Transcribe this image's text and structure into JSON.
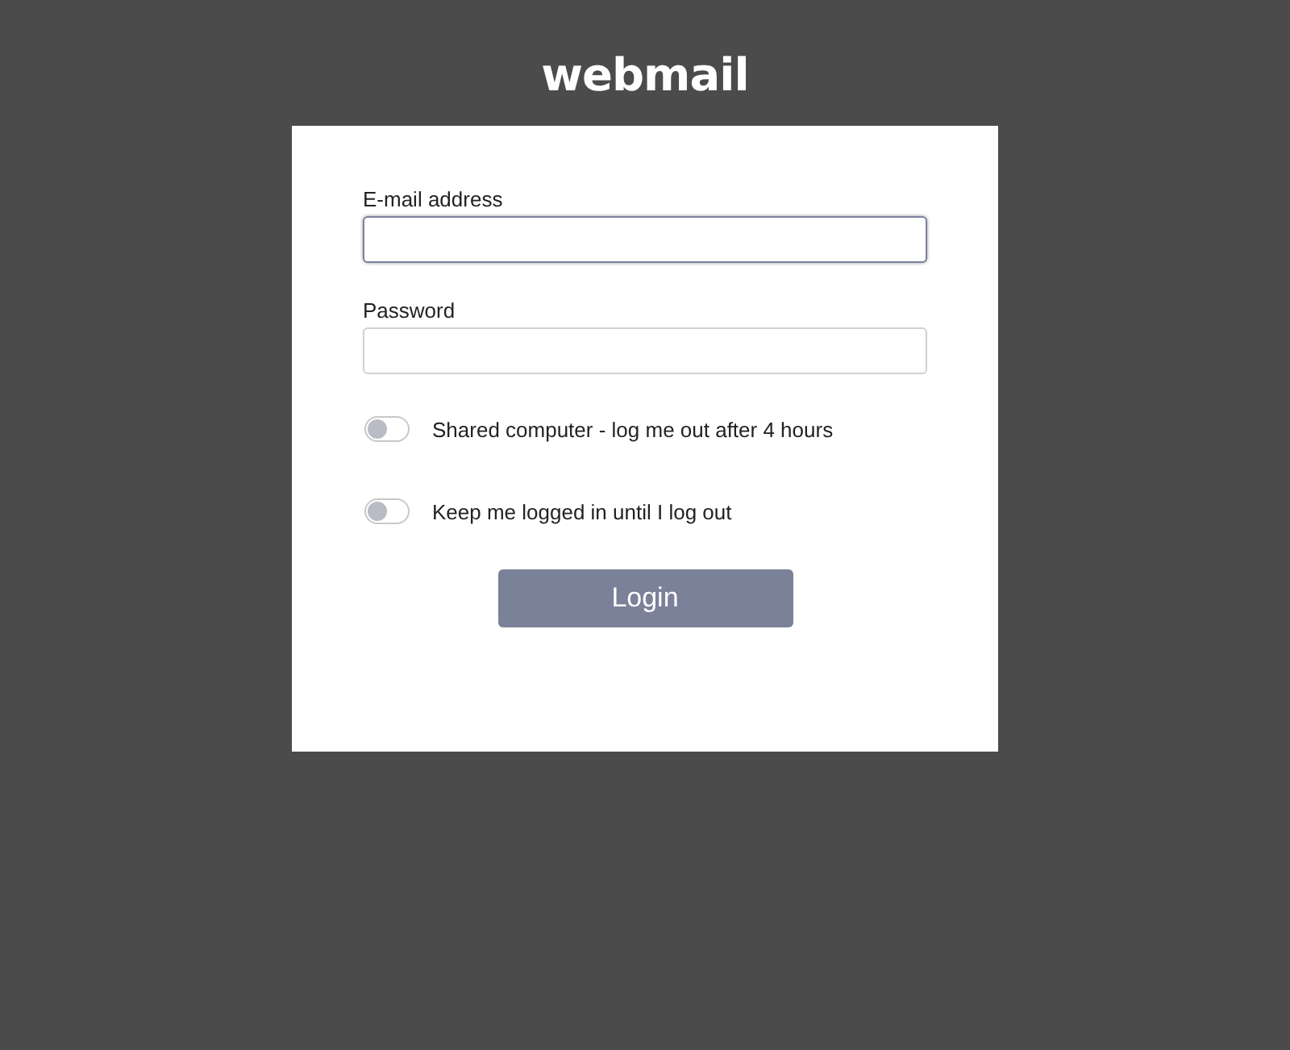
{
  "logo": "webmail",
  "fields": [
    {
      "label": "E-mail address",
      "focused": true
    },
    {
      "label": "Password",
      "focused": false
    }
  ],
  "toggles": [
    {
      "label": "Shared computer - log me out after 4 hours",
      "on": false
    },
    {
      "label": "Keep me logged in until I log out",
      "on": false
    }
  ],
  "login_button": "Login"
}
